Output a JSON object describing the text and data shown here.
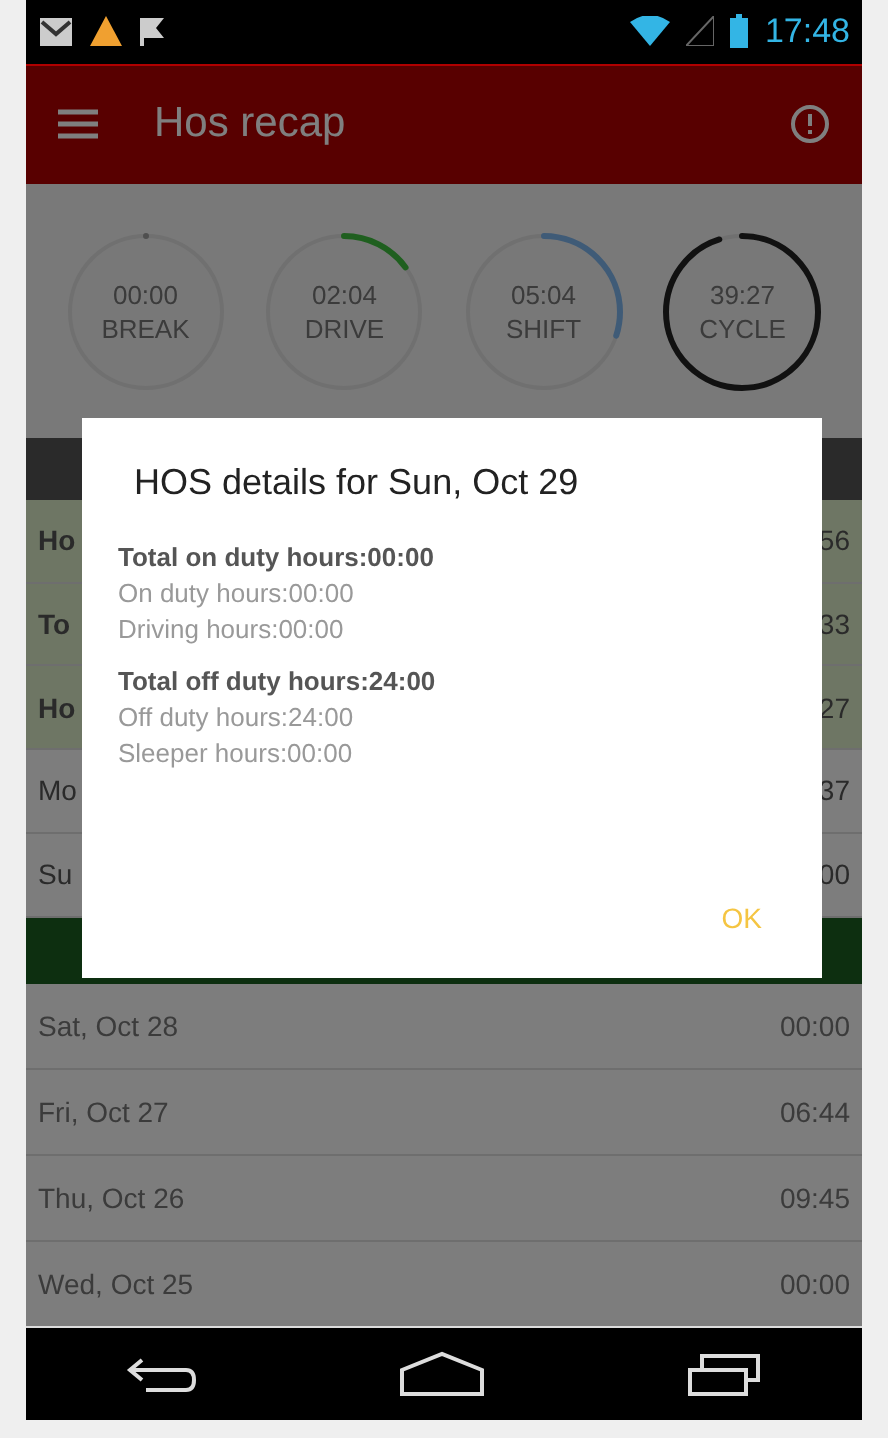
{
  "status_bar": {
    "time": "17:48"
  },
  "app_bar": {
    "title": "Hos recap"
  },
  "gauges": [
    {
      "value": "00:00",
      "label": "BREAK",
      "level": 0,
      "kind": "break"
    },
    {
      "value": "02:04",
      "label": "DRIVE",
      "level": 0.15,
      "kind": "drive"
    },
    {
      "value": "05:04",
      "label": "SHIFT",
      "level": 0.3,
      "kind": "shift"
    },
    {
      "value": "39:27",
      "label": "CYCLE",
      "level": 0.95,
      "kind": "cycle"
    }
  ],
  "summary_rows": [
    {
      "label": "Ho",
      "value": "56",
      "highlighted": true
    },
    {
      "label": "To",
      "value": "33",
      "highlighted": true
    },
    {
      "label": "Ho",
      "value": "27",
      "highlighted": true
    },
    {
      "label": "Mo",
      "value": "37",
      "highlighted": false
    },
    {
      "label": "Su",
      "value": "00",
      "highlighted": false
    }
  ],
  "day_rows": [
    {
      "label": "Sat, Oct 28",
      "value": "00:00"
    },
    {
      "label": "Fri, Oct 27",
      "value": "06:44"
    },
    {
      "label": "Thu, Oct 26",
      "value": "09:45"
    },
    {
      "label": "Wed, Oct 25",
      "value": "00:00"
    }
  ],
  "dialog": {
    "title": "HOS details for Sun, Oct 29",
    "sections": [
      {
        "heading": "Total on duty hours:00:00",
        "lines": [
          "On duty hours:00:00",
          "Driving hours:00:00"
        ]
      },
      {
        "heading": "Total off duty hours:24:00",
        "lines": [
          "Off duty hours:24:00",
          "Sleeper hours:00:00"
        ]
      }
    ],
    "button": "OK"
  }
}
